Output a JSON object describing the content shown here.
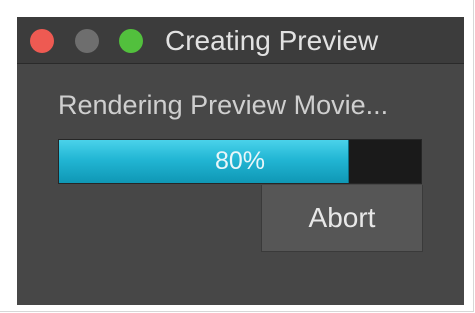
{
  "window": {
    "title": "Creating Preview"
  },
  "message": "Rendering Preview Movie...",
  "progress": {
    "value": 0.8,
    "label": "80%"
  },
  "abort_label": "Abort",
  "colors": {
    "close": "#ee5a52",
    "minimize": "#6e6e6e",
    "zoom": "#52c03d",
    "title_text": "#e2e2e2",
    "message_text": "#cfcfcf",
    "progress_text": "#e9f6f9",
    "button_text": "#e8e8e8"
  }
}
